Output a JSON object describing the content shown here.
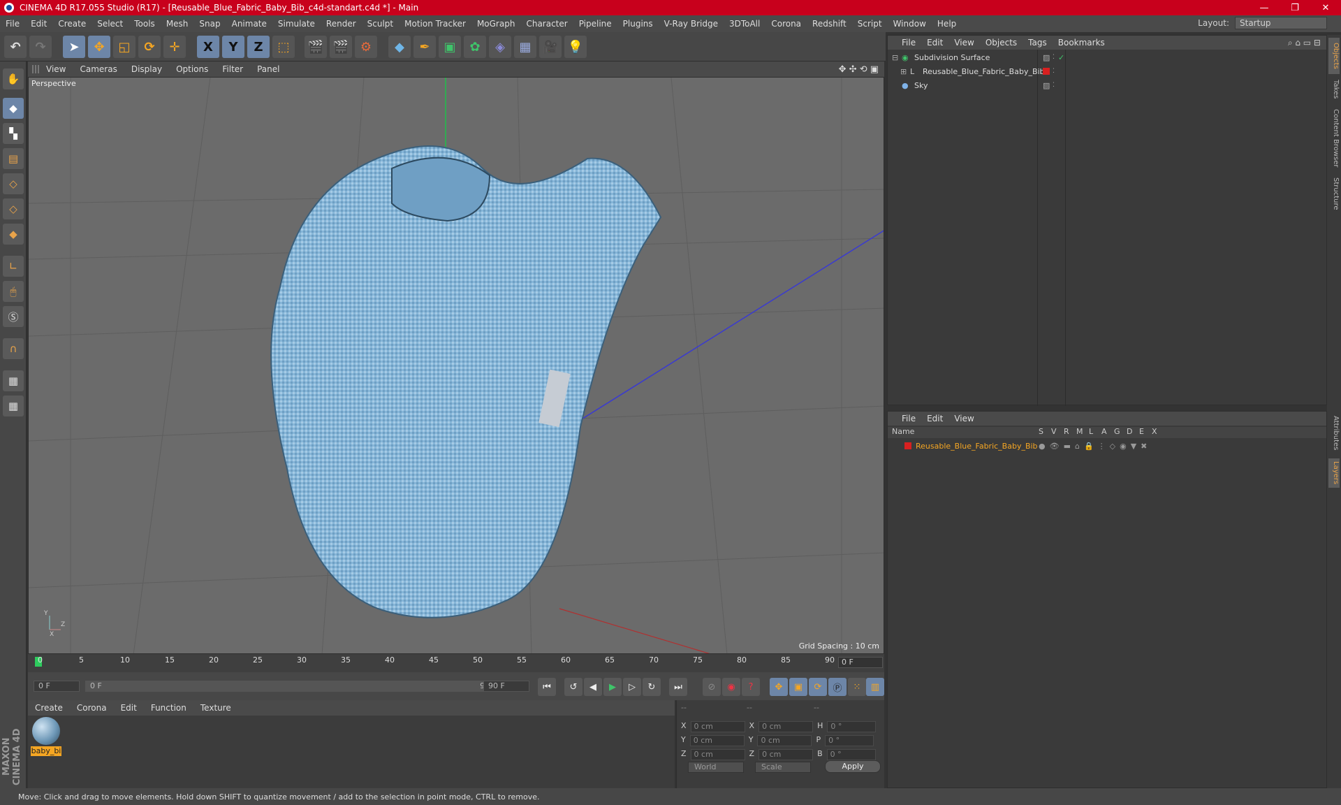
{
  "window": {
    "title": "CINEMA 4D R17.055 Studio (R17) - [Reusable_Blue_Fabric_Baby_Bib_c4d-standart.c4d *] - Main",
    "controls": [
      "—",
      "❐",
      "✕"
    ]
  },
  "menubar": {
    "items": [
      "File",
      "Edit",
      "Create",
      "Select",
      "Tools",
      "Mesh",
      "Snap",
      "Animate",
      "Simulate",
      "Render",
      "Sculpt",
      "Motion Tracker",
      "MoGraph",
      "Character",
      "Pipeline",
      "Plugins",
      "V-Ray Bridge",
      "3DToAll",
      "Corona",
      "Redshift",
      "Script",
      "Window",
      "Help"
    ],
    "layout_label": "Layout:",
    "layout_value": "Startup"
  },
  "toolbar": {
    "axis_x": "X",
    "axis_y": "Y",
    "axis_z": "Z"
  },
  "viewport": {
    "menu": [
      "View",
      "Cameras",
      "Display",
      "Options",
      "Filter",
      "Panel"
    ],
    "label": "Perspective",
    "grid_spacing": "Grid Spacing : 10 cm",
    "axis_x": "X",
    "axis_y": "Y",
    "axis_z": "Z"
  },
  "timeline": {
    "ticks": [
      "0",
      "5",
      "10",
      "15",
      "20",
      "25",
      "30",
      "35",
      "40",
      "45",
      "50",
      "55",
      "60",
      "65",
      "70",
      "75",
      "80",
      "85",
      "90"
    ],
    "current_frame": "0 F"
  },
  "transport": {
    "start": "0 F",
    "range_start": "0 F",
    "range_end": "90 F",
    "end": "90 F"
  },
  "material_manager": {
    "menu": [
      "Create",
      "Corona",
      "Edit",
      "Function",
      "Texture"
    ],
    "material_name": "baby_bi"
  },
  "coordinates": {
    "headers": [
      "--",
      "--",
      "--"
    ],
    "rows": [
      {
        "a": "X",
        "v1": "0 cm",
        "b": "X",
        "v2": "0 cm",
        "c": "H",
        "v3": "0 °"
      },
      {
        "a": "Y",
        "v1": "0 cm",
        "b": "Y",
        "v2": "0 cm",
        "c": "P",
        "v3": "0 °"
      },
      {
        "a": "Z",
        "v1": "0 cm",
        "b": "Z",
        "v2": "0 cm",
        "c": "B",
        "v3": "0 °"
      }
    ],
    "mode_world": "World",
    "mode_scale": "Scale",
    "apply": "Apply"
  },
  "object_manager": {
    "menu": [
      "File",
      "Edit",
      "View",
      "Objects",
      "Tags",
      "Bookmarks"
    ],
    "objects": [
      {
        "name": "Subdivision Surface"
      },
      {
        "name": "Reusable_Blue_Fabric_Baby_Bib"
      },
      {
        "name": "Sky"
      }
    ]
  },
  "layer_manager": {
    "menu": [
      "File",
      "Edit",
      "View"
    ],
    "columns": [
      "Name",
      "S",
      "V",
      "R",
      "M",
      "L",
      "A",
      "G",
      "D",
      "E",
      "X"
    ],
    "layer_name": "Reusable_Blue_Fabric_Baby_Bib"
  },
  "right_tabs": [
    "Objects",
    "Takes",
    "Content Browser",
    "Structure",
    "Attributes",
    "Layers"
  ],
  "status": "Move: Click and drag to move elements. Hold down SHIFT to quantize movement / add to the selection in point mode, CTRL to remove.",
  "branding": "MAXON CINEMA 4D",
  "colors": {
    "titlebar": "#c8001c",
    "accent": "#f5a623",
    "selection": "#6d86a8",
    "bib": "#7fb2d6"
  }
}
